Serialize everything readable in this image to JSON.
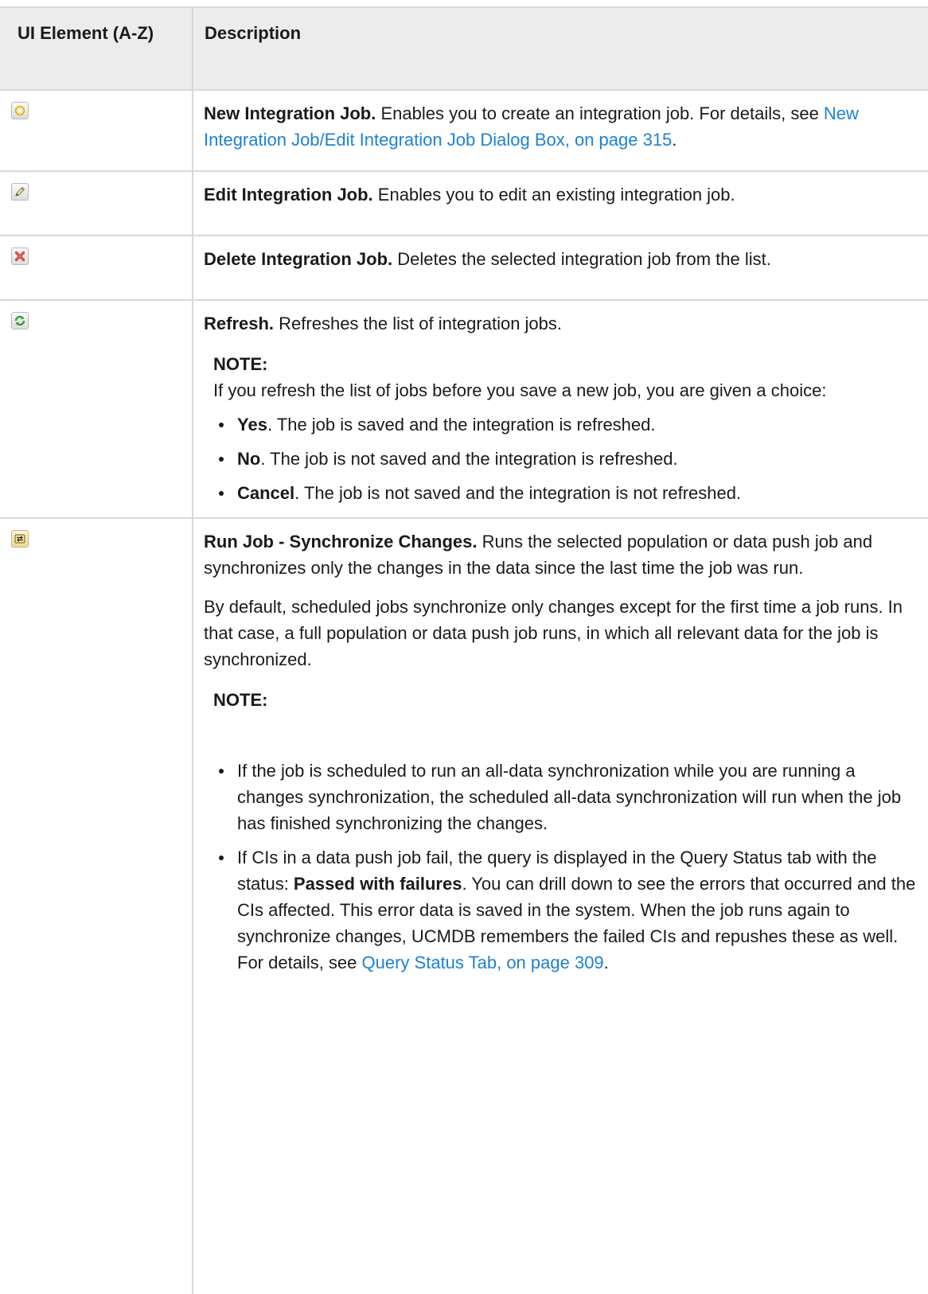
{
  "table": {
    "headers": {
      "element": "UI Element (A-Z)",
      "description": "Description"
    },
    "rows": {
      "new_job": {
        "icon": "new-star-icon",
        "title": "New Integration Job.",
        "text": " Enables you to create an integration job. For details, see ",
        "link": "New Integration Job/Edit Integration Job Dialog Box, on page 315",
        "after_link": "."
      },
      "edit_job": {
        "icon": "pencil-icon",
        "title": "Edit Integration Job.",
        "text": " Enables you to edit an existing integration job."
      },
      "delete_job": {
        "icon": "delete-x-icon",
        "title": "Delete Integration Job.",
        "text": " Deletes the selected integration job from the list."
      },
      "refresh": {
        "icon": "refresh-icon",
        "title": "Refresh.",
        "text": " Refreshes the list of integration jobs.",
        "note_title": "NOTE:",
        "note_text": "If you refresh the list of jobs before you save a new job, you are given a choice:",
        "choices": [
          {
            "label": "Yes",
            "text": ". The job is saved and the integration is refreshed."
          },
          {
            "label": "No",
            "text": ". The job is not saved and the integration is refreshed."
          },
          {
            "label": "Cancel",
            "text": ". The job is not saved and the integration is not refreshed."
          }
        ]
      },
      "run_job": {
        "icon": "sync-changes-icon",
        "title": "Run Job - Synchronize Changes.",
        "text": " Runs the selected population or data push job and synchronizes only the changes in the data since the last time the job was run.",
        "paragraph": "By default, scheduled jobs synchronize only changes except for the first time a job runs. In that case, a full population or data push job runs, in which all relevant data for the job is synchronized.",
        "note_title": "NOTE:",
        "bullet1": "If the job is scheduled to run an all-data synchronization while you are running a changes synchronization, the scheduled all-data synchronization will run when the job has finished synchronizing the changes.",
        "bullet2_before": "If CIs in a data push job fail, the query is displayed in the Query Status tab with the status: ",
        "bullet2_bold": "Passed with failures",
        "bullet2_after": ". You can drill down to see the errors that occurred and the CIs affected. This error data is saved in the system. When the job runs again to synchronize changes, UCMDB remembers the failed CIs and repushes these as well. For details, see ",
        "bullet2_link": "Query Status Tab, on page 309",
        "bullet2_end": "."
      }
    }
  }
}
